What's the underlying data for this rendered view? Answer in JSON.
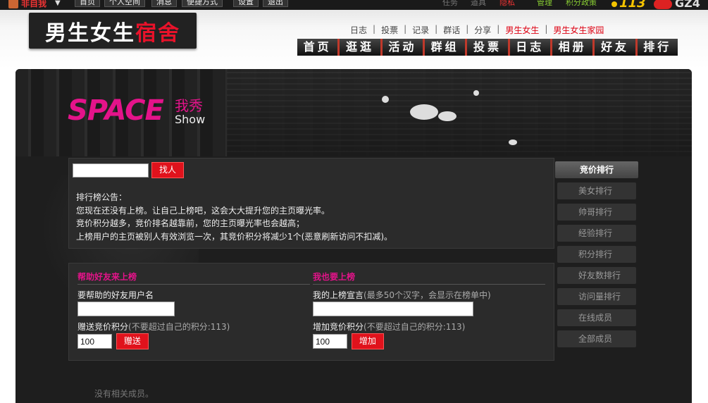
{
  "topbar": {
    "me_label": "非自我",
    "buttons": [
      "首页",
      "个人空间",
      "消息",
      "便捷方式",
      "设置",
      "退出"
    ],
    "right_links": [
      "任务",
      "道具",
      "隐私",
      "管理",
      "积分政策"
    ],
    "coins": "113",
    "site": "GZ4"
  },
  "header": {
    "logo_white": "男生女生",
    "logo_red": "宿舍",
    "sublinks": [
      "日志",
      "投票",
      "记录",
      "群话",
      "分享",
      "男生女生",
      "男生女生家园"
    ],
    "nav": [
      "首页",
      "逛逛",
      "活动",
      "群组",
      "投票",
      "日志",
      "相册",
      "好友",
      "排行"
    ]
  },
  "banner": {
    "logo": "SPACE",
    "cn": "我秀",
    "show": "Show"
  },
  "search": {
    "button": "找人",
    "value": ""
  },
  "announce": {
    "title": "排行榜公告：",
    "lines": [
      "您现在还没有上榜。让自己上榜吧，这会大大提升您的主页曝光率。",
      "竞价积分越多，竞价排名越靠前，您的主页曝光率也会越高；",
      "上榜用户的主页被别人有效浏览一次，其竞价积分将减少1个(恶意刷新访问不扣减)。"
    ]
  },
  "help": {
    "title": "帮助好友来上榜",
    "username_label": "要帮助的好友用户名",
    "username_value": "",
    "points_label": "赠送竞价积分",
    "points_note": "(不要超过自己的积分:113)",
    "points_value": "100",
    "button": "赠送"
  },
  "self": {
    "title": "我也要上榜",
    "declaration_label": "我的上榜宣言",
    "declaration_note": "(最多50个汉字，会显示在榜单中)",
    "declaration_value": "",
    "points_label": "增加竞价积分",
    "points_note": "(不要超过自己的积分:113)",
    "points_value": "100",
    "button": "增加"
  },
  "rank": {
    "head": "竞价排行",
    "items": [
      "美女排行",
      "帅哥排行",
      "经验排行",
      "积分排行",
      "好友数排行",
      "访问量排行",
      "在线成员",
      "全部成员"
    ]
  },
  "footer": {
    "text": "没有相关成员。"
  },
  "colors": {
    "brand_red": "#e0121c",
    "magenta": "#e4138a",
    "panel_bg": "#2b2b2b"
  }
}
